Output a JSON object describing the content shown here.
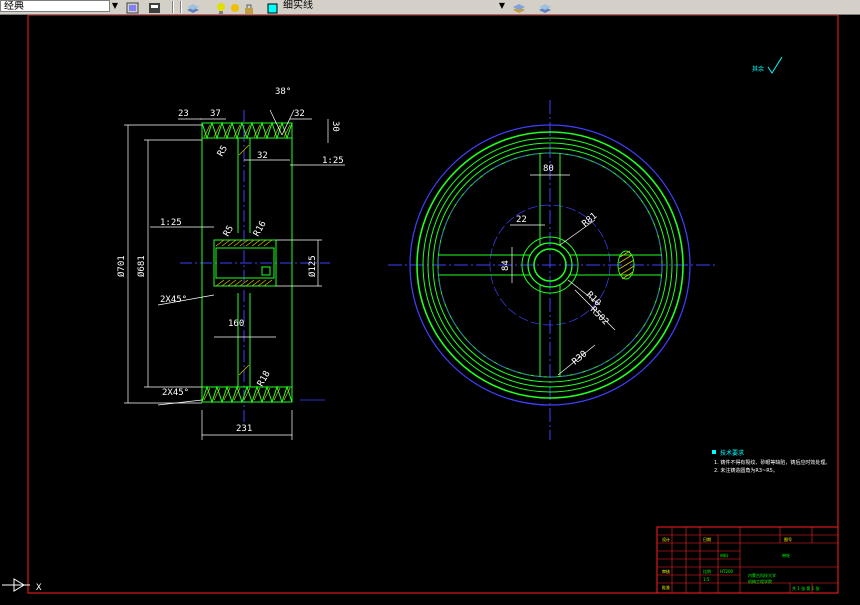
{
  "toolbar": {
    "style_combo": "经典",
    "linetype_combo": "细实线"
  },
  "drawing": {
    "roughness_mark": "其余",
    "left_view": {
      "dims": {
        "d23": "23",
        "d37": "37",
        "angle38": "38°",
        "d32_top": "32",
        "d30": "30",
        "r5_top": "R5",
        "d32_mid": "32",
        "taper_right": "1:25",
        "taper_left": "1:25",
        "r5_hub": "R5",
        "r16": "R16",
        "phi701": "Ø701",
        "phi681": "Ø681",
        "phi125": "Ø125",
        "chamfer_hub": "2X45°",
        "d160": "160",
        "r18": "R18",
        "chamfer_bottom": "2X45°",
        "d231": "231"
      }
    },
    "right_view": {
      "dims": {
        "d80": "80",
        "d22": "22",
        "r81": "R81",
        "d84": "84",
        "r10": "R10",
        "r502": "R502",
        "r30": "R30"
      }
    },
    "notes": {
      "title": "技术要求",
      "line1": "1. 铸件不得有裂纹、砂眼等缺陷，铸后应时效处理。",
      "line2": "2. 未注铸造圆角为R3~R5。"
    },
    "title_block": {
      "part_name": "带轮",
      "school": "内蒙古科技大学",
      "subtitle": "机械工程学院",
      "label_design": "设计",
      "label_check": "审核",
      "label_scale": "比例",
      "label_material": "材料",
      "material": "HT200",
      "scale": "1:5",
      "sheet": "共 1 张 第 1 张",
      "drawing_no": "图号",
      "label_approve": "批准",
      "label_date": "日期"
    },
    "ucs": {
      "x_label": "X"
    }
  }
}
